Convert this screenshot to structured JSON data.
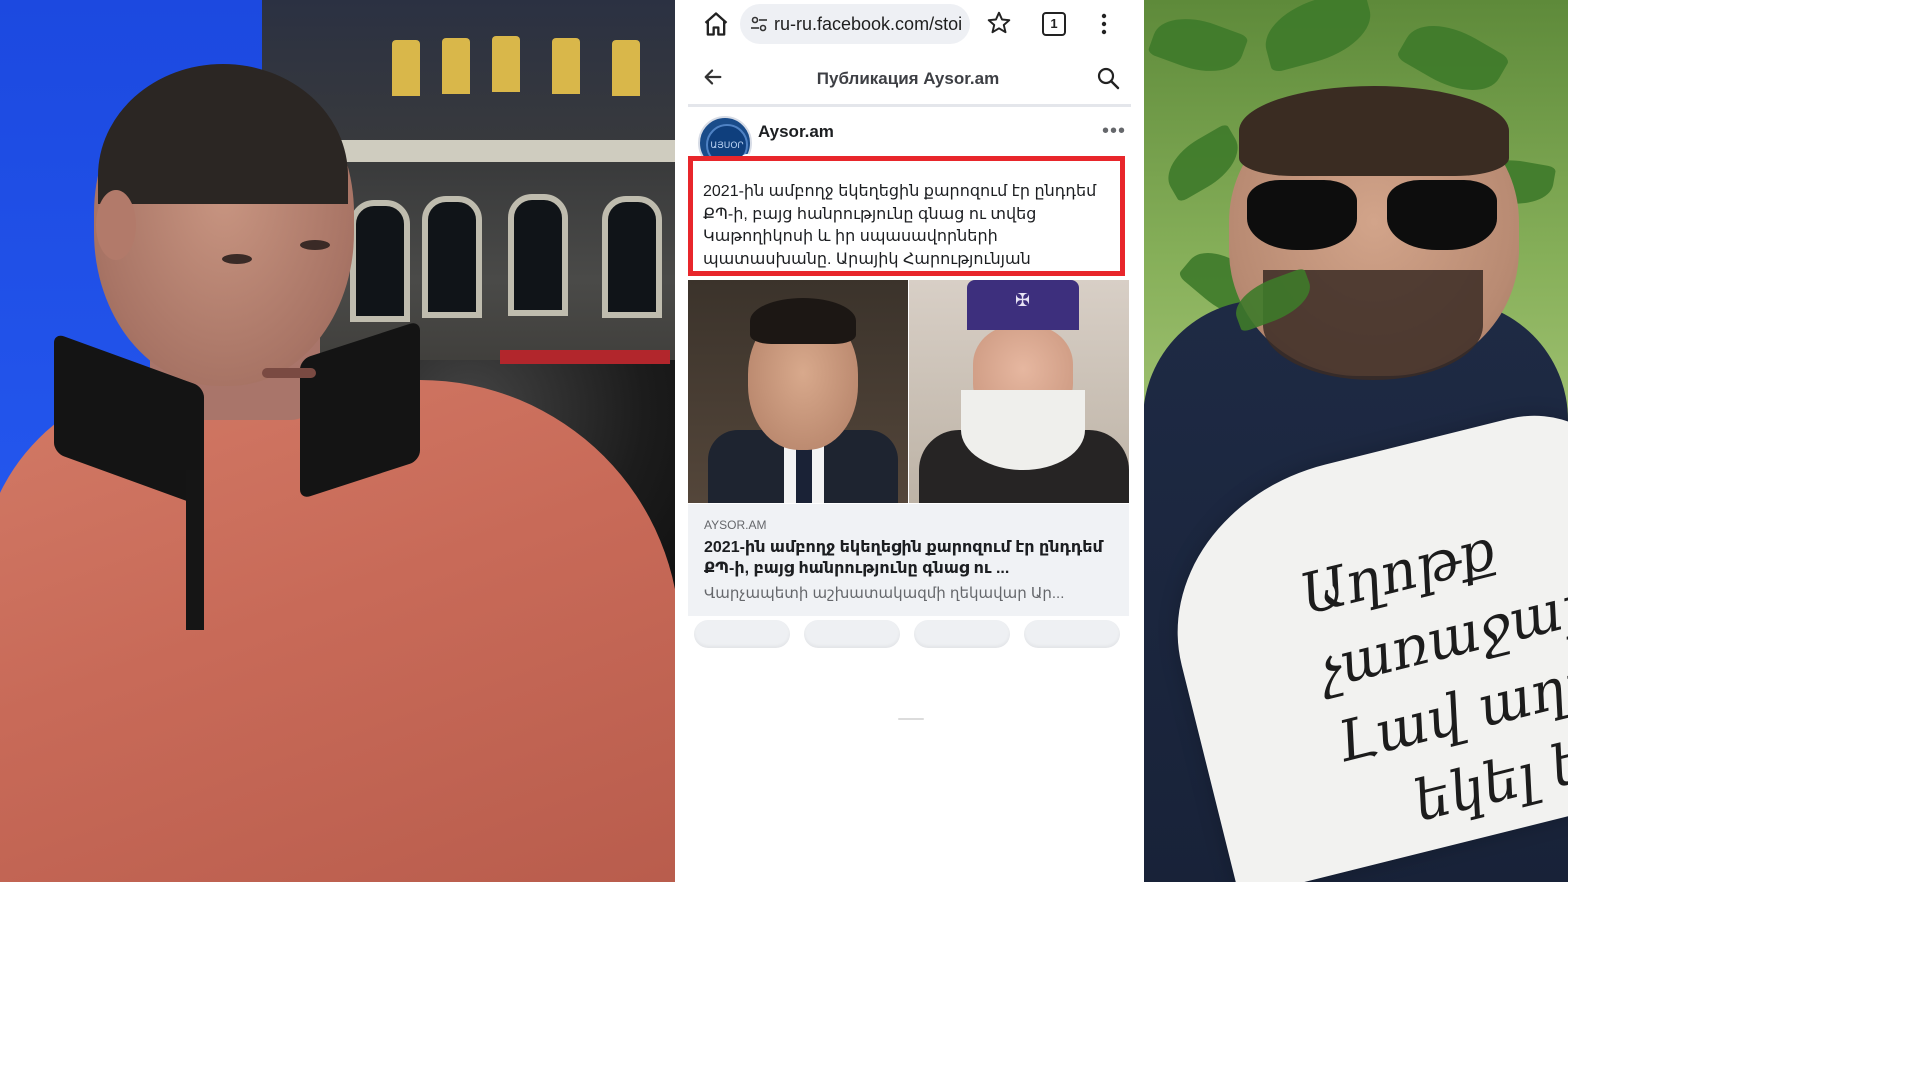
{
  "browser": {
    "url": "ru-ru.facebook.com/stoi",
    "tab_count": "1",
    "icons": [
      "home-icon",
      "site-settings-icon",
      "star-icon",
      "tabs-icon",
      "more-vert-icon"
    ]
  },
  "fb_header": {
    "title": "Публикация Aysor.am",
    "icons": [
      "back-arrow-icon",
      "search-icon"
    ]
  },
  "post": {
    "page_name": "Aysor.am",
    "avatar_text": "ԱՅՍՕՐ",
    "more": "•••",
    "text": "2021-ին ամբողջ եկեղեցին քարոզում էր ընդդեմ ՔՊ-ի, բայց հանրությունը գնաց ու տվեց Կաթողիկոսի և իր սպասավորների պատասխանը. Արայիկ Հարությունյան",
    "highlight_color": "#e8262b"
  },
  "link_card": {
    "domain": "AYSOR.AM",
    "title": "2021-ին ամբողջ եկեղեցին քարոզում էր ընդդեմ ՔՊ-ի, բայց հանրությունը գնաց ու ...",
    "description": "Վարչապետի աշխատակազմի ղեկավար Ար..."
  },
  "right_photo": {
    "sign_lines": [
      "Աղոթք",
      "չառաջարկե՛լ",
      "Լավ աղոթել",
      "եկել եմ"
    ]
  },
  "colors": {
    "fb_text": "#1c1e21",
    "fb_secondary": "#65676b",
    "card_bg": "#f0f2f5",
    "left_wall_blue": "#2457ee"
  }
}
